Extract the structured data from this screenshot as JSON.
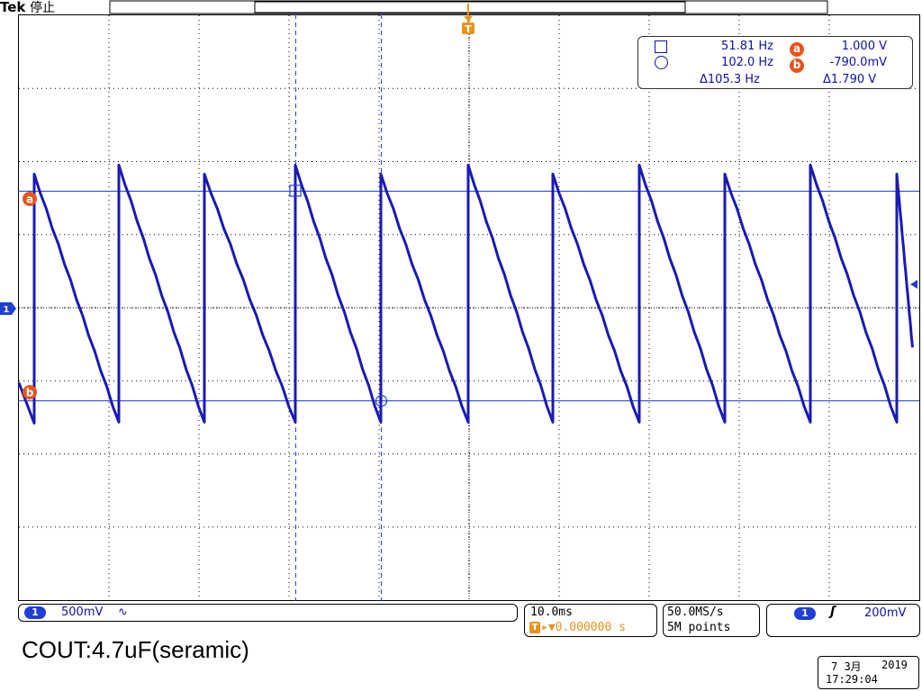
{
  "header": {
    "brand": "Tek",
    "status": "停止"
  },
  "measurements": {
    "cursor1_freq": "51.81 Hz",
    "cursor2_freq": "102.0 Hz",
    "delta_freq": "105.3 Hz",
    "cursor_a_volt": "1.000 V",
    "cursor_b_volt": "-790.0mV",
    "delta_volt": "1.790 V",
    "label_a": "a",
    "label_b": "b",
    "delta_symbol": "Δ"
  },
  "channel": {
    "marker": "1",
    "scale": "500mV",
    "coupling_symbol": "∿"
  },
  "timebase": {
    "per_div": "10.0ms",
    "trigger_pos_icon": "T",
    "trigger_offset": "▸▼0.000000 s"
  },
  "acquisition": {
    "sample_rate": "50.0MS/s",
    "record_length": "5M points"
  },
  "trigger": {
    "source": "1",
    "slope_symbol": "ʃ",
    "level": "200mV"
  },
  "caption": "COUT:4.7uF(seramic)",
  "date": {
    "day_month": "7 3月",
    "year": "2019",
    "time": "17:29:04"
  },
  "colors": {
    "trace": "#1a1ab4",
    "grid": "#000000",
    "cursor": "#1f3fd6",
    "accent": "#e8521a"
  },
  "icons": {
    "square_cursor": "square-icon",
    "circle_cursor": "circle-icon"
  },
  "waveform": {
    "type": "sawtooth",
    "volts_per_div": 0.5,
    "seconds_per_div": 0.01,
    "peak_v": 1.0,
    "trough_v": -0.79
  }
}
